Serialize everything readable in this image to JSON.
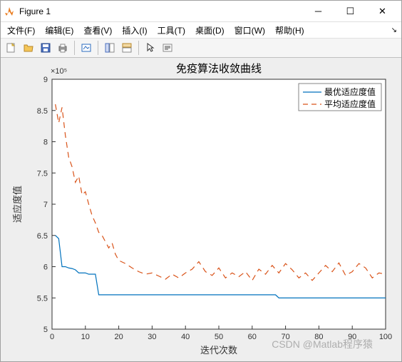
{
  "window": {
    "title": "Figure 1"
  },
  "menu": {
    "file": "文件(F)",
    "edit": "编辑(E)",
    "view": "查看(V)",
    "insert": "插入(I)",
    "tools": "工具(T)",
    "desktop": "桌面(D)",
    "window": "窗口(W)",
    "help": "帮助(H)"
  },
  "watermark": "CSDN @Matlab程序猿",
  "chart_data": {
    "type": "line",
    "title": "免疫算法收敛曲线",
    "xlabel": "迭代次数",
    "ylabel": "适应度值",
    "y_exponent": "×10⁵",
    "xlim": [
      0,
      100
    ],
    "ylim": [
      5,
      9
    ],
    "xticks": [
      0,
      10,
      20,
      30,
      40,
      50,
      60,
      70,
      80,
      90,
      100
    ],
    "yticks": [
      5,
      5.5,
      6,
      6.5,
      7,
      7.5,
      8,
      8.5,
      9
    ],
    "legend": {
      "position": "northeast"
    },
    "series": [
      {
        "name": "最优适应度值",
        "color": "#0072bd",
        "style": "solid",
        "x": [
          1,
          2,
          3,
          4,
          5,
          6,
          7,
          8,
          9,
          10,
          11,
          12,
          13,
          14,
          15,
          16,
          20,
          25,
          30,
          35,
          40,
          45,
          50,
          55,
          60,
          65,
          67,
          68,
          70,
          75,
          80,
          85,
          90,
          95,
          100
        ],
        "y": [
          6.5,
          6.45,
          6.0,
          6.0,
          5.98,
          5.97,
          5.95,
          5.9,
          5.9,
          5.9,
          5.88,
          5.88,
          5.88,
          5.55,
          5.55,
          5.55,
          5.55,
          5.55,
          5.55,
          5.55,
          5.55,
          5.55,
          5.55,
          5.55,
          5.55,
          5.55,
          5.55,
          5.5,
          5.5,
          5.5,
          5.5,
          5.5,
          5.5,
          5.5,
          5.5
        ]
      },
      {
        "name": "平均适应度值",
        "color": "#d95319",
        "style": "dashed",
        "x": [
          1,
          2,
          3,
          4,
          5,
          6,
          7,
          8,
          9,
          10,
          11,
          12,
          13,
          14,
          15,
          16,
          17,
          18,
          19,
          20,
          22,
          24,
          26,
          28,
          30,
          32,
          34,
          36,
          38,
          40,
          42,
          44,
          46,
          48,
          50,
          52,
          54,
          56,
          58,
          60,
          62,
          64,
          66,
          68,
          70,
          72,
          74,
          76,
          78,
          80,
          82,
          84,
          86,
          88,
          90,
          92,
          94,
          96,
          98,
          100
        ],
        "y": [
          8.6,
          8.3,
          8.55,
          8.1,
          7.75,
          7.6,
          7.35,
          7.45,
          7.15,
          7.2,
          7.0,
          6.82,
          6.7,
          6.55,
          6.5,
          6.4,
          6.3,
          6.38,
          6.2,
          6.1,
          6.05,
          5.98,
          5.92,
          5.88,
          5.9,
          5.85,
          5.8,
          5.88,
          5.82,
          5.9,
          5.96,
          6.08,
          5.92,
          5.86,
          5.98,
          5.82,
          5.9,
          5.84,
          5.92,
          5.78,
          5.96,
          5.88,
          6.02,
          5.9,
          6.05,
          5.95,
          5.82,
          5.9,
          5.78,
          5.9,
          6.02,
          5.92,
          6.06,
          5.86,
          5.92,
          6.05,
          5.98,
          5.82,
          5.9,
          5.88
        ]
      }
    ]
  }
}
